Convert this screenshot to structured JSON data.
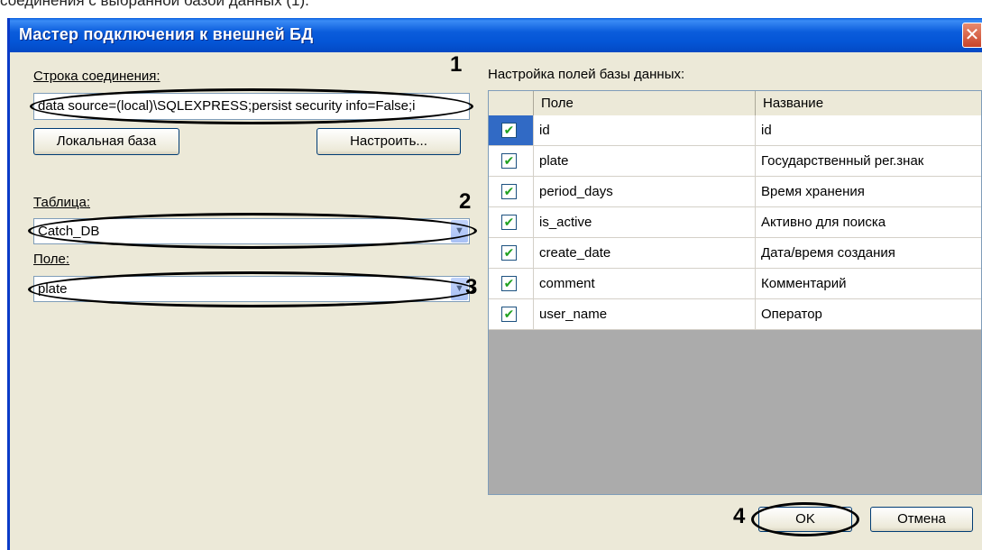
{
  "caption": "соединения с выбранной базой данных (1).",
  "window": {
    "title": "Мастер подключения к внешней БД",
    "close_glyph": "✕"
  },
  "connection": {
    "label": "Строка соединения:",
    "value": "data source=(local)\\SQLEXPRESS;persist security info=False;i",
    "local_db_button": "Локальная база",
    "configure_button": "Настроить..."
  },
  "table": {
    "label": "Таблица:",
    "value": "Catch_DB"
  },
  "field": {
    "label": "Поле:",
    "value": "plate"
  },
  "db_fields": {
    "label": "Настройка полей базы данных:",
    "columns": [
      "Поле",
      "Название"
    ],
    "rows": [
      {
        "field": "id",
        "name": "id",
        "checked": true
      },
      {
        "field": "plate",
        "name": "Государственный рег.знак",
        "checked": true
      },
      {
        "field": "period_days",
        "name": "Время хранения",
        "checked": true
      },
      {
        "field": "is_active",
        "name": "Активно для поиска",
        "checked": true
      },
      {
        "field": "create_date",
        "name": "Дата/время создания",
        "checked": true
      },
      {
        "field": "comment",
        "name": "Комментарий",
        "checked": true
      },
      {
        "field": "user_name",
        "name": "Оператор",
        "checked": true
      }
    ]
  },
  "buttons": {
    "ok": "OK",
    "cancel": "Отмена"
  },
  "markers": [
    "1",
    "2",
    "3",
    "4"
  ],
  "icons": {
    "checkbox": "check-icon",
    "dropdown": "chevron-down-icon"
  }
}
